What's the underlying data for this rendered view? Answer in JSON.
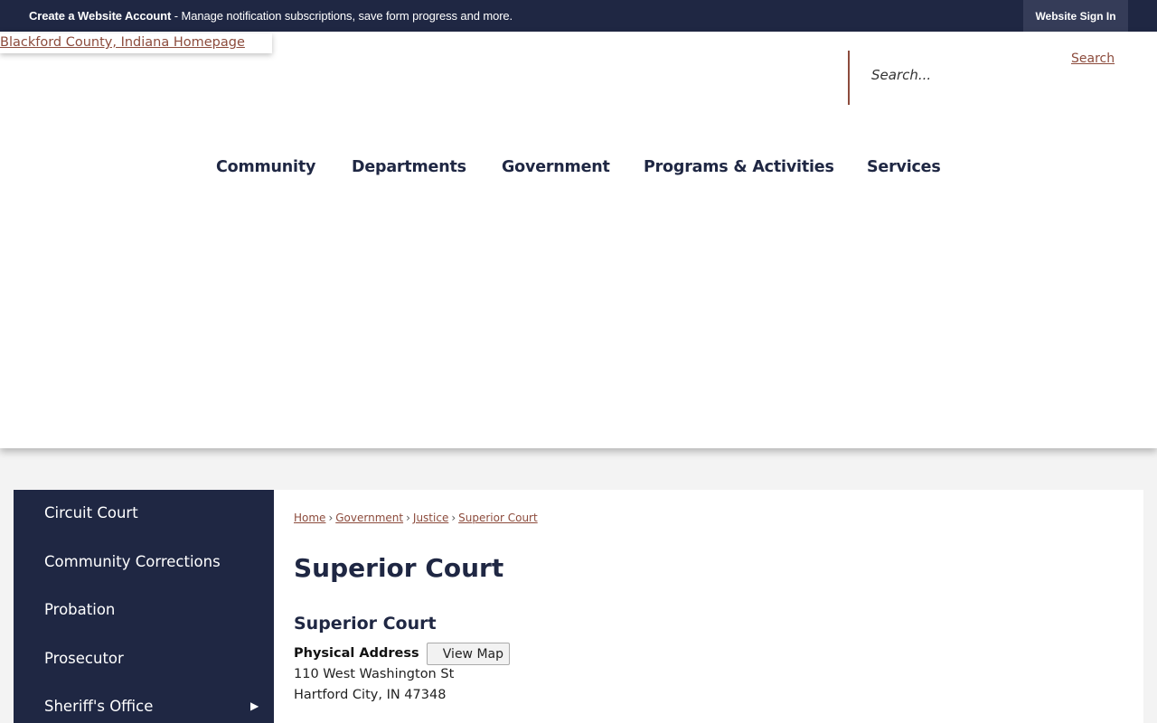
{
  "topbar": {
    "promo_bold": "Create a Website Account",
    "promo_rest": " - Manage notification subscriptions, save form progress and more.",
    "signin_label": "Website Sign In"
  },
  "header": {
    "logo_alt": "Blackford County, Indiana Homepage",
    "search_placeholder": "Search...",
    "search_button": "Search"
  },
  "nav": {
    "items": [
      {
        "label": "Community"
      },
      {
        "label": "Departments"
      },
      {
        "label": "Government"
      },
      {
        "label": "Programs & Activities"
      },
      {
        "label": "Services"
      }
    ]
  },
  "sidebar": {
    "items": [
      {
        "label": "Circuit Court"
      },
      {
        "label": "Community Corrections"
      },
      {
        "label": "Probation"
      },
      {
        "label": "Prosecutor"
      },
      {
        "label": "Sheriff's Office",
        "has_submenu": true
      }
    ]
  },
  "breadcrumb": [
    "Home",
    "Government",
    "Justice",
    "Superior Court"
  ],
  "content": {
    "page_title": "Superior Court",
    "section_title": "Superior Court",
    "address_label": "Physical Address",
    "view_map": "View Map",
    "address_line1": "110 West Washington St",
    "address_line2": "Hartford City, IN 47348"
  },
  "colors": {
    "navy": "#1f2743",
    "link": "#8c4b3c",
    "page_bg": "#f3f3f3"
  }
}
